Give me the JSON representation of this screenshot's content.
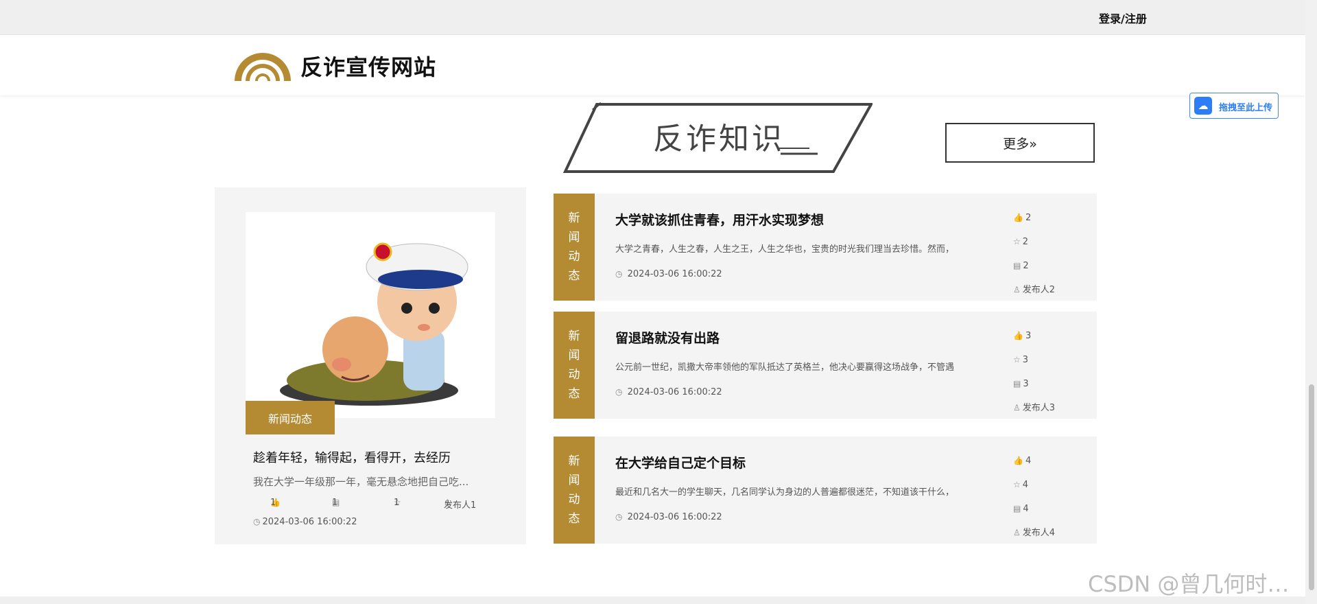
{
  "topbar": {
    "login_label": "登录/注册"
  },
  "header": {
    "site_title": "反诈宣传网站"
  },
  "section": {
    "title": "反诈知识",
    "more_label": "更多»"
  },
  "featured": {
    "tag": "新闻动态",
    "title": "趁着年轻，输得起，看得开，去经历",
    "summary": "我在大学一年级那一年，毫无悬念地把自己吃...",
    "likes": "1",
    "comments": "1",
    "favorites": "1",
    "publisher": "发布人1",
    "date": "2024-03-06 16:00:22"
  },
  "articles": [
    {
      "tag": [
        "新",
        "闻",
        "动",
        "态"
      ],
      "title": "大学就该抓住青春，用汗水实现梦想",
      "summary": "大学之青春，人生之春，人生之王，人生之华也，宝贵的时光我们理当去珍惜。然而，",
      "date": "2024-03-06 16:00:22",
      "likes": "2",
      "favorites": "2",
      "comments": "2",
      "publisher": "发布人2"
    },
    {
      "tag": [
        "新",
        "闻",
        "动",
        "态"
      ],
      "title": "留退路就没有出路",
      "summary": "公元前一世纪，凯撒大帝率领他的军队抵达了英格兰，他决心要赢得这场战争，不管遇",
      "date": "2024-03-06 16:00:22",
      "likes": "3",
      "favorites": "3",
      "comments": "3",
      "publisher": "发布人3"
    },
    {
      "tag": [
        "新",
        "闻",
        "动",
        "态"
      ],
      "title": "在大学给自己定个目标",
      "summary": "最近和几名大一的学生聊天，几名同学认为身边的人普遍都很迷茫，不知道该干什么，",
      "date": "2024-03-06 16:00:22",
      "likes": "4",
      "favorites": "4",
      "comments": "4",
      "publisher": "发布人4"
    }
  ],
  "upload": {
    "label": "拖拽至此上传"
  },
  "watermark": "CSDN @曾几何时…",
  "icons": {
    "like": "thumbs-up-icon",
    "favorite": "star-icon",
    "comment": "comment-icon",
    "publisher": "user-icon",
    "date": "clock-icon"
  },
  "colors": {
    "accent": "#b48b33",
    "upload": "#2d7df6"
  }
}
